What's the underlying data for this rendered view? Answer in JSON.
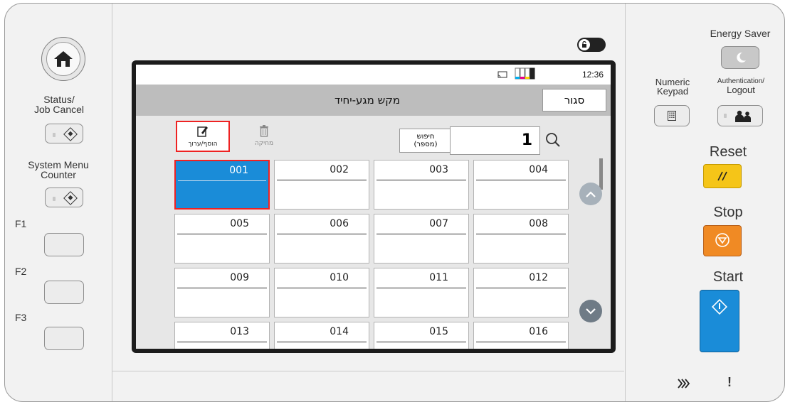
{
  "left_panel": {
    "status_label_1": "Status/",
    "status_label_2": "Job Cancel",
    "system_label_1": "System Menu",
    "system_label_2": "Counter",
    "f1": "F1",
    "f2": "F2",
    "f3": "F3"
  },
  "screen": {
    "time": "12:36",
    "title": "מקש מגע-יחיד",
    "close_label": "סגור",
    "add_edit_label": "הוסף/ערוך",
    "delete_label": "מחיקה",
    "search_label_1": "חיפוש",
    "search_label_2": "(מספר)",
    "search_value": "1",
    "cells": [
      "001",
      "002",
      "003",
      "004",
      "005",
      "006",
      "007",
      "008",
      "009",
      "010",
      "011",
      "012",
      "013",
      "014",
      "015",
      "016"
    ]
  },
  "right_panel": {
    "energy_saver": "Energy Saver",
    "numeric_1": "Numeric",
    "numeric_2": "Keypad",
    "auth_1": "Authentication/",
    "auth_2": "Logout",
    "reset": "Reset",
    "stop": "Stop",
    "start": "Start",
    "bottom_indicator_2": "!"
  },
  "colors": {
    "selected_cell": "#1a8cd8",
    "highlight_border": "#e22222",
    "reset_button": "#f5c518",
    "stop_button": "#f08a24",
    "start_button": "#1a8cd8",
    "scroll_button": "#6f7b86"
  }
}
